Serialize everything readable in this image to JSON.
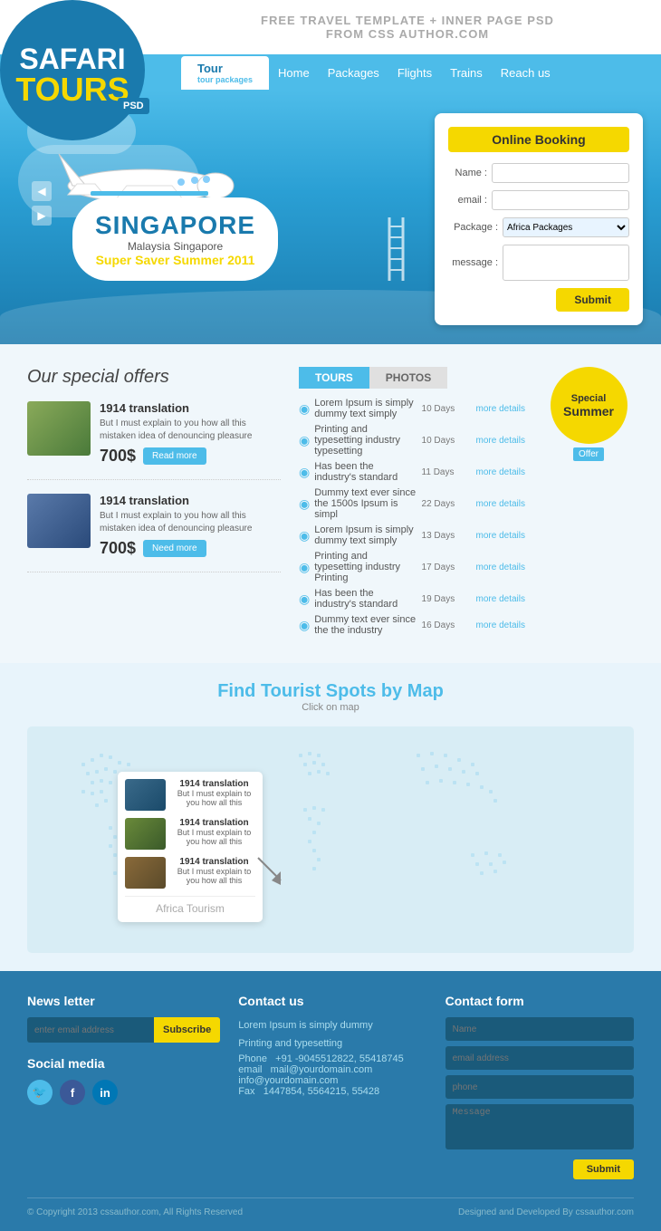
{
  "logo": {
    "safari": "SAFARI",
    "tours": "TOURS",
    "psd": "PSD"
  },
  "header": {
    "tagline": "FREE TRAVEL TEMPLATE + INNER PAGE PSD",
    "tagline2": "FROM CSS AUTHOR.COM"
  },
  "nav": {
    "tour_btn": "Tour",
    "tour_sub": "tour packages",
    "links": [
      "Home",
      "Packages",
      "Flights",
      "Trains",
      "Reach us"
    ]
  },
  "hero": {
    "destination": "SINGAPORE",
    "sub1": "Malaysia Singapore",
    "sub2": "Super Saver Summer 2011"
  },
  "booking": {
    "title": "Online Booking",
    "name_label": "Name :",
    "email_label": "email :",
    "package_label": "Package :",
    "message_label": "message :",
    "package_value": "Africa Packages",
    "submit": "Submit",
    "name_placeholder": "",
    "email_placeholder": "",
    "message_placeholder": ""
  },
  "offers": {
    "section_title": "Our special offers",
    "items": [
      {
        "title": "1914 translation",
        "desc": "But I must explain to you how all this mistaken idea of denouncing pleasure",
        "price": "700$",
        "btn": "Read more"
      },
      {
        "title": "1914 translation",
        "desc": "But I must explain to you how all this mistaken idea of denouncing pleasure",
        "price": "700$",
        "btn": "Need more"
      }
    ]
  },
  "tabs": {
    "tab1": "TOURS",
    "tab2": "PHOTOS"
  },
  "tours": [
    {
      "name": "Lorem Ipsum is simply dummy text simply",
      "days": "10 Days",
      "more": "more details"
    },
    {
      "name": "Printing and typesetting industry typesetting",
      "days": "10 Days",
      "more": "more details"
    },
    {
      "name": "Has been the industry's standard",
      "days": "11 Days",
      "more": "more details"
    },
    {
      "name": "Dummy text ever since the 1500s Ipsum is simpl",
      "days": "22 Days",
      "more": "more details"
    },
    {
      "name": "Lorem Ipsum is simply dummy text simply",
      "days": "13 Days",
      "more": "more details"
    },
    {
      "name": "Printing and typesetting industry Printing",
      "days": "17 Days",
      "more": "more details"
    },
    {
      "name": "Has been the industry's standard",
      "days": "19 Days",
      "more": "more details"
    },
    {
      "name": "Dummy text ever since the the industry",
      "days": "16 Days",
      "more": "more details"
    }
  ],
  "special_badge": {
    "special": "Special",
    "summer": "Summer",
    "offer": "Offer"
  },
  "map": {
    "title": "Find Tourist Spots by Map",
    "subtitle": "Click on map",
    "africa_label": "Africa Tourism",
    "popup_items": [
      {
        "title": "1914 translation",
        "desc": "But I must explain to you how all this"
      },
      {
        "title": "1914 translation",
        "desc": "But I must explain to you how all this"
      },
      {
        "title": "1914 translation",
        "desc": "But I must explain to you how all this"
      }
    ]
  },
  "footer": {
    "newsletter_title": "News letter",
    "newsletter_placeholder": "enter email address",
    "subscribe_btn": "Subscribe",
    "social_title": "Social media",
    "contact_title": "Contact us",
    "contact_desc": "Lorem Ipsum is simply dummy",
    "contact_desc2": "Printing and typesetting",
    "phone_label": "Phone",
    "phone_value": "+91 -9045512822, 55418745",
    "email_label": "email",
    "email_value": "mail@yourdomain.com",
    "info_label": "",
    "info_value": "info@yourdomain.com",
    "fax_label": "Fax",
    "fax_value": "1447854, 5564215, 55428",
    "form_title": "Contact form",
    "name_ph": "Name",
    "email_ph": "email address",
    "phone_ph": "phone",
    "message_ph": "Message",
    "submit_btn": "Submit",
    "copyright": "© Copyright 2013 cssauthor.com, All Rights Reserved",
    "designed": "Designed and Developed By cssauthor.com"
  }
}
